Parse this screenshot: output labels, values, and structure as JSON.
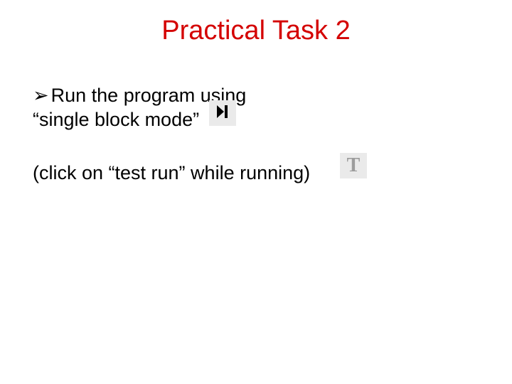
{
  "title": "Practical Task 2",
  "line1_prefix": "Run the program using",
  "line2": "“single block mode”",
  "line3": "(click on “test run” while running)",
  "icons": {
    "single_block_label": "single-block-mode",
    "test_run_letter": "T"
  }
}
